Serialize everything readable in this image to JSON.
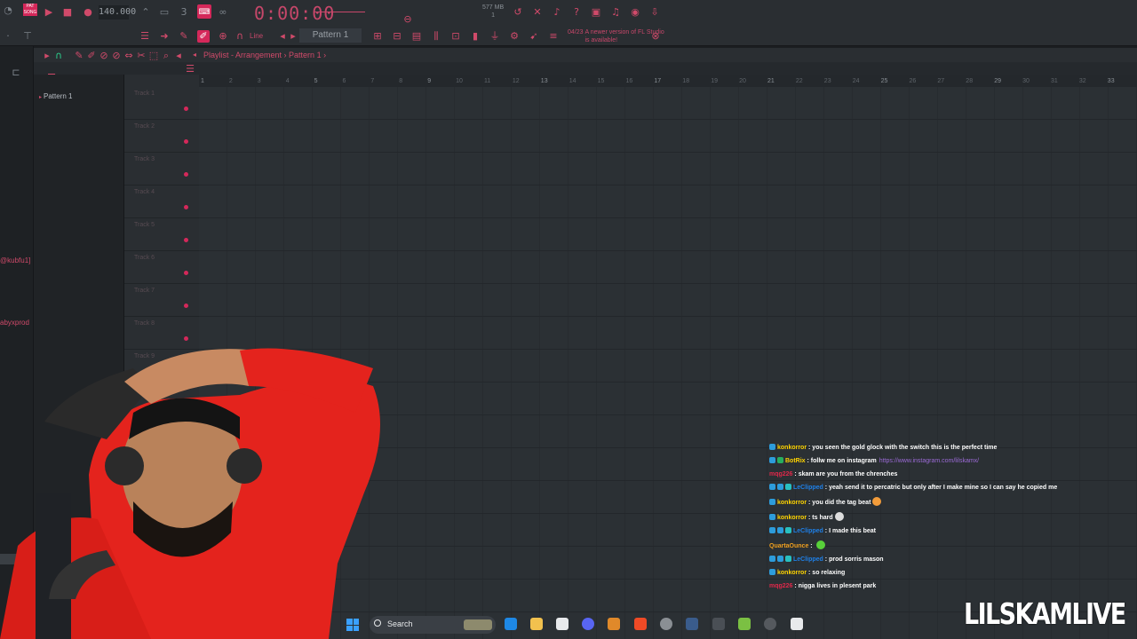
{
  "toolbar": {
    "song_mode_label": "PAT SONG",
    "bpm": "140.000",
    "time_display": "0:00",
    "time_frames": "00",
    "time_unit": "M:S:CS",
    "pattern_selector": "Pattern 1",
    "snap_mode": "Line",
    "memory_usage": "577 MB",
    "cpu_indicator": "1",
    "news_date": "04/23",
    "news_text": "A newer version of FL Studio is available!"
  },
  "playlist": {
    "breadcrumb_title": "Playlist - Arrangement",
    "breadcrumb_pattern": "Pattern 1",
    "pattern_list": [
      "Pattern 1"
    ],
    "ruler": [
      "1",
      "2",
      "3",
      "4",
      "5",
      "6",
      "7",
      "8",
      "9",
      "10",
      "11",
      "12",
      "13",
      "14",
      "15",
      "16",
      "17",
      "18",
      "19",
      "20",
      "21",
      "22",
      "23",
      "24",
      "25",
      "26",
      "27",
      "28",
      "29",
      "30",
      "31",
      "32",
      "33"
    ],
    "tracks": [
      "Track 1",
      "Track 2",
      "Track 3",
      "Track 4",
      "Track 5",
      "Track 6",
      "Track 7",
      "Track 8",
      "Track 9"
    ]
  },
  "left_panel": {
    "tag_1": "@kubfu1]",
    "tag_2": "abyxprod"
  },
  "chat": [
    {
      "user": "konkorror",
      "color": "#ffd400",
      "badges": [
        "blue"
      ],
      "message": "you seen the gold glock with the switch this is the perfect time",
      "emote": null
    },
    {
      "user": "BotRix",
      "color": "#ffd400",
      "badges": [
        "blue",
        "green"
      ],
      "message": "follw me on instagram",
      "link": "https://www.instagram.com/lilskamx/",
      "emote": null
    },
    {
      "user": "mqg226",
      "color": "#e0284a",
      "badges": [],
      "message": "skam are you from the chrenches",
      "emote": null
    },
    {
      "user": "LeClipped",
      "color": "#1e7fe6",
      "badges": [
        "blue",
        "blue",
        "teal"
      ],
      "message": "yeah send it to percatric but only after I make mine so I can say he copied me",
      "emote": null
    },
    {
      "user": "konkorror",
      "color": "#ffd400",
      "badges": [
        "blue"
      ],
      "message": "you did the tag beat",
      "emote": "#f39c3a"
    },
    {
      "user": "konkorror",
      "color": "#ffd400",
      "badges": [
        "blue"
      ],
      "message": "ts hard",
      "emote": "#dddddd"
    },
    {
      "user": "LeClipped",
      "color": "#1e7fe6",
      "badges": [
        "blue",
        "blue",
        "teal"
      ],
      "message": "I made this beat",
      "emote": null
    },
    {
      "user": "QuartaOunce",
      "color": "#f0a020",
      "badges": [],
      "message": "",
      "emote": "#58d03a"
    },
    {
      "user": "LeClipped",
      "color": "#1e7fe6",
      "badges": [
        "blue",
        "blue",
        "teal"
      ],
      "message": "prod sorris mason",
      "emote": null
    },
    {
      "user": "konkorror",
      "color": "#ffd400",
      "badges": [
        "blue"
      ],
      "message": "so relaxing",
      "emote": null
    },
    {
      "user": "mqg226",
      "color": "#e0284a",
      "badges": [],
      "message": "nigga lives in plesent park",
      "emote": null
    }
  ],
  "taskbar": {
    "search_label": "Search"
  },
  "stream_brand": "LILSKAMLIVE",
  "colors": {
    "accent": "#d4285a",
    "toolbar_bg": "#2a2e32",
    "grid_bg": "#2b3034",
    "link": "#9b6ad6"
  }
}
